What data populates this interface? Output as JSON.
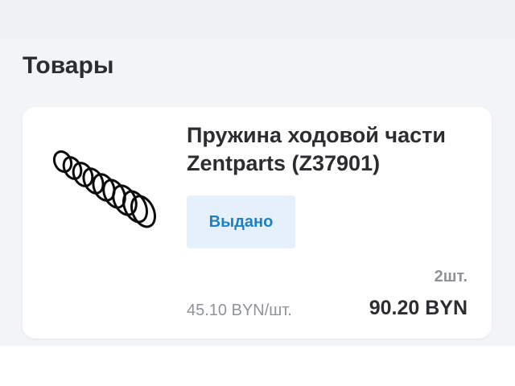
{
  "section": {
    "title": "Товары"
  },
  "item": {
    "name": "Пружина ходовой части Zentparts (Z37901)",
    "image_icon": "coil-spring-icon",
    "status": "Выдано",
    "quantity": "2шт.",
    "unit_price": "45.10 BYN/шт.",
    "total_price": "90.20 BYN"
  },
  "colors": {
    "status_text": "#1f7fc4",
    "status_bg": "#e6f0fa",
    "card_bg": "#ffffff",
    "page_bg": "#f3f4f6"
  }
}
